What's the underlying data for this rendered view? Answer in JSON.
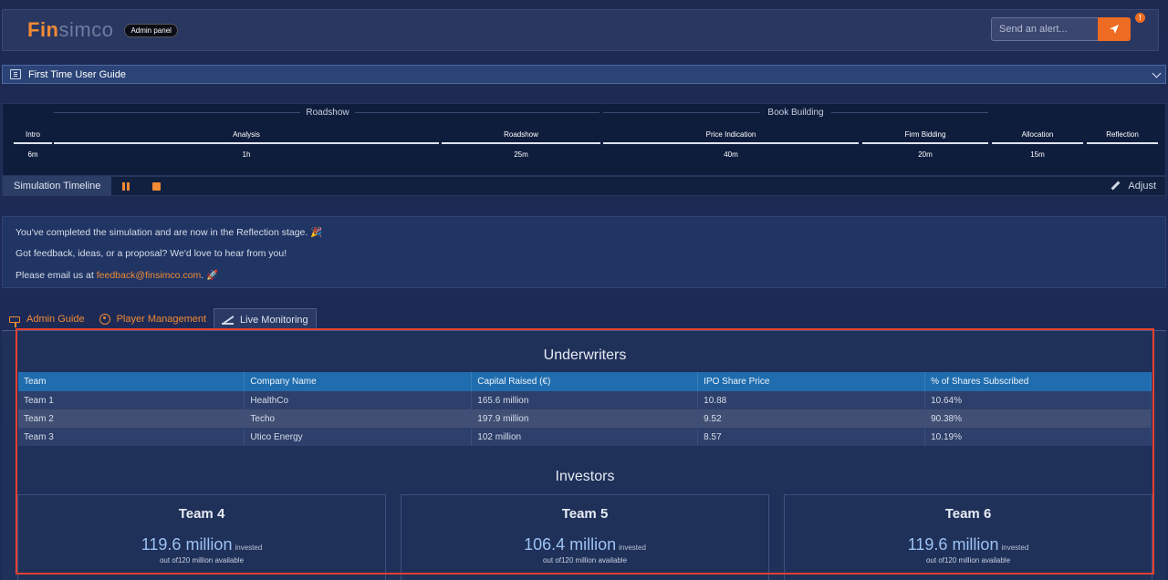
{
  "header": {
    "logo_part1": "Fin",
    "logo_part2": "simco",
    "badge": "Admin panel",
    "alert_placeholder": "Send an alert...",
    "notification_count": "!"
  },
  "guide": {
    "title": "First Time User Guide"
  },
  "timeline": {
    "groups": [
      "Roadshow",
      "Book Building"
    ],
    "stages": [
      {
        "label": "Intro",
        "duration": "6m"
      },
      {
        "label": "Analysis",
        "duration": "1h"
      },
      {
        "label": "Roadshow",
        "duration": "25m"
      },
      {
        "label": "Price Indication",
        "duration": "40m"
      },
      {
        "label": "Firm Bidding",
        "duration": "20m"
      },
      {
        "label": "Allocation",
        "duration": "15m"
      },
      {
        "label": "Reflection",
        "duration": ""
      }
    ],
    "label": "Simulation Timeline",
    "adjust_label": "Adjust"
  },
  "message": {
    "line1": "You've completed the simulation and are now in the Reflection stage. 🎉",
    "line2": "Got feedback, ideas, or a proposal? We'd love to hear from you!",
    "line3_prefix": "Please email us at ",
    "email": "feedback@finsimco.com",
    "line3_suffix": ". 🚀"
  },
  "tabs": [
    "Admin Guide",
    "Player Management",
    "Live Monitoring"
  ],
  "underwriters": {
    "title": "Underwriters",
    "columns": [
      "Team",
      "Company Name",
      "Capital Raised (€)",
      "IPO Share Price",
      "% of Shares Subscribed"
    ],
    "rows": [
      [
        "Team 1",
        "HealthCo",
        "165.6 million",
        "10.88",
        "10.64%"
      ],
      [
        "Team 2",
        "Techo",
        "197.9 million",
        "9.52",
        "90.38%"
      ],
      [
        "Team 3",
        "Utico Energy",
        "102 million",
        "8.57",
        "10.19%"
      ]
    ]
  },
  "investors": {
    "title": "Investors",
    "cards": [
      {
        "team": "Team 4",
        "amount": "119.6 million",
        "label": "invested",
        "sub": "out of120 million available"
      },
      {
        "team": "Team 5",
        "amount": "106.4 million",
        "label": "invested",
        "sub": "out of120 million available"
      },
      {
        "team": "Team 6",
        "amount": "119.6 million",
        "label": "invested",
        "sub": "out of120 million available"
      }
    ]
  }
}
